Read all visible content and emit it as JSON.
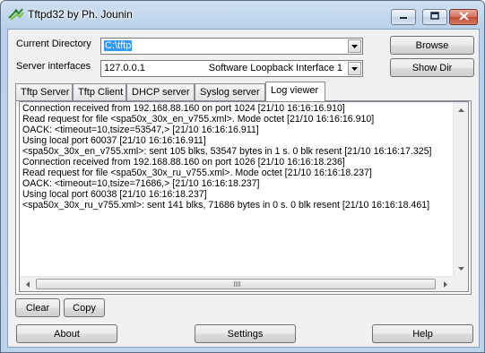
{
  "window": {
    "title": "Tftpd32 by Ph. Jounin"
  },
  "directory": {
    "label": "Current Directory",
    "value": "C:\\tftp",
    "browse_label": "Browse"
  },
  "server": {
    "label": "Server interfaces",
    "ip": "127.0.0.1",
    "interface_name": "Software Loopback Interface 1",
    "showdir_label": "Show Dir"
  },
  "tabs": [
    {
      "label": "Tftp Server"
    },
    {
      "label": "Tftp Client"
    },
    {
      "label": "DHCP server"
    },
    {
      "label": "Syslog server"
    },
    {
      "label": "Log viewer",
      "active": true
    }
  ],
  "log_lines": [
    "Connection received from 192.168.88.160 on port 1024 [21/10 16:16:16.910]",
    "Read request for file <spa50x_30x_en_v755.xml>. Mode octet [21/10 16:16:16.910]",
    "OACK: <timeout=10,tsize=53547,> [21/10 16:16:16.911]",
    "Using local port 60037 [21/10 16:16:16.911]",
    "<spa50x_30x_en_v755.xml>: sent 105 blks, 53547 bytes in 1 s. 0 blk resent [21/10 16:16:17.325]",
    "Connection received from 192.168.88.160 on port 1026 [21/10 16:16:18.236]",
    "Read request for file <spa50x_30x_ru_v755.xml>. Mode octet [21/10 16:16:18.237]",
    "OACK: <timeout=10,tsize=71686,> [21/10 16:16:18.237]",
    "Using local port 60038 [21/10 16:16:18.237]",
    "<spa50x_30x_ru_v755.xml>: sent 141 blks, 71686 bytes in 0 s. 0 blk resent [21/10 16:16:18.461]"
  ],
  "log_actions": {
    "clear_label": "Clear",
    "copy_label": "Copy"
  },
  "footer": {
    "about_label": "About",
    "settings_label": "Settings",
    "help_label": "Help"
  },
  "colors": {
    "selection": "#3399ff",
    "close_button": "#c44a33"
  }
}
